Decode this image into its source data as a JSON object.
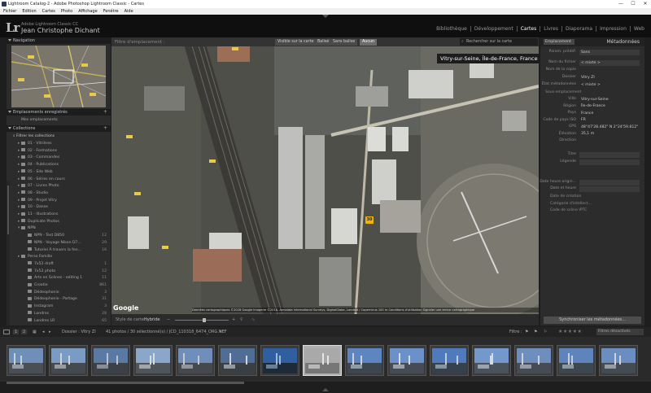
{
  "window": {
    "title": "Lightroom Catalog-2 - Adobe Photoshop Lightroom Classic - Cartes",
    "controls": [
      "—",
      "☐",
      "✕"
    ]
  },
  "menu": [
    "Fichier",
    "Edition",
    "Cartes",
    "Photo",
    "Affichage",
    "Fenêtre",
    "Aide"
  ],
  "identity": {
    "logo": "Lr",
    "product": "Adobe Lightroom Classic CC",
    "user": "Jean Christophe Dichant"
  },
  "modules": {
    "items": [
      "Bibliothèque",
      "Développement",
      "Cartes",
      "Livres",
      "Diaporama",
      "Impression",
      "Web"
    ],
    "active": "Cartes"
  },
  "left_panel": {
    "navigator_title": "Navigation",
    "saved_locations_title": "Emplacements enregistrés",
    "my_locations": "Mes emplacements",
    "collections_title": "Collections",
    "filter_collections": "Filtrer les collections",
    "collections": [
      {
        "toggle": "▸",
        "name": "01 - Vitrières",
        "count": ""
      },
      {
        "toggle": "▸",
        "name": "02 - Formations",
        "count": ""
      },
      {
        "toggle": "▸",
        "name": "03 - Commandes",
        "count": ""
      },
      {
        "toggle": "▸",
        "name": "04 - Publications",
        "count": ""
      },
      {
        "toggle": "▸",
        "name": "05 - Site Web",
        "count": ""
      },
      {
        "toggle": "▸",
        "name": "06 - Séries en cours",
        "count": ""
      },
      {
        "toggle": "▸",
        "name": "07 - Livres Photo",
        "count": ""
      },
      {
        "toggle": "▸",
        "name": "08 - Studio",
        "count": ""
      },
      {
        "toggle": "▸",
        "name": "09 - Projet Vitry",
        "count": ""
      },
      {
        "toggle": "▸",
        "name": "10 - Danse",
        "count": ""
      },
      {
        "toggle": "▸",
        "name": "11 - Illustrations",
        "count": ""
      },
      {
        "toggle": "▸",
        "name": "Duplicate Photos",
        "count": ""
      },
      {
        "toggle": "▾",
        "name": "NPN",
        "count": ""
      },
      {
        "toggle": "",
        "name": "NPN - Test D850",
        "count": "12"
      },
      {
        "toggle": "",
        "name": "NPN - Voyage Nikon D7...",
        "count": "29"
      },
      {
        "toggle": "",
        "name": "Tutoriel À travers la fen...",
        "count": "16"
      },
      {
        "toggle": "▸",
        "name": "Perso Famille",
        "count": ""
      },
      {
        "toggle": "",
        "name": "7x52 draft",
        "count": "1"
      },
      {
        "toggle": "",
        "name": "7x52 photo",
        "count": "12"
      },
      {
        "toggle": "",
        "name": "Arts en Scènes - editing 1",
        "count": "11"
      },
      {
        "toggle": "",
        "name": "Croatie",
        "count": "861"
      },
      {
        "toggle": "",
        "name": "Dédeophonie",
        "count": "3"
      },
      {
        "toggle": "",
        "name": "Dédeophonie - Partage",
        "count": "31"
      },
      {
        "toggle": "",
        "name": "Instagram",
        "count": "3"
      },
      {
        "toggle": "",
        "name": "Londres",
        "count": "28"
      },
      {
        "toggle": "",
        "name": "Londres LR",
        "count": "65"
      }
    ]
  },
  "map": {
    "filter_label": "Filtre d'emplacement :",
    "filter_buttons": [
      "Visible sur la carte",
      "Balisé",
      "Sans balise",
      "Aucun"
    ],
    "active_filter": "Aucun",
    "search_placeholder": "Rechercher sur la carte",
    "location_tag": "Vitry-sur-Seine, Île-de-France, France",
    "pin_label": "30",
    "google": "Google",
    "copyright": "Données cartographiques ©2018 Google Imagerie ©2018, Aerodata International Surveys, DigitalGlobe, Landsat / Copernicus  100 m   Conditions d'utilisation   Signaler une erreur cartographique",
    "toolbar": {
      "style_label": "Style de carte :",
      "style_value": "Hybride"
    }
  },
  "right_panel": {
    "preset_dropdown": "Emplacement",
    "title": "Métadonnées",
    "preset_label": "Param. prédéf.",
    "preset_value": "Sans",
    "rows": [
      {
        "k": "Nom du fichier",
        "v": "< mixte >",
        "field": true
      },
      {
        "k": "Nom de la copie",
        "v": "",
        "field": false
      },
      {
        "k": "Dossier",
        "v": "Vitry ZI",
        "field": false
      },
      {
        "k": "État métadonnées",
        "v": "< mixte >",
        "field": false
      }
    ],
    "section_location": "Sous-emplacement",
    "location_rows": [
      {
        "k": "Ville",
        "v": "Vitry-sur-Seine"
      },
      {
        "k": "Région",
        "v": "Île-de-France"
      },
      {
        "k": "Pays",
        "v": "France"
      },
      {
        "k": "Code de pays ISO",
        "v": "FR"
      },
      {
        "k": "GPS",
        "v": "48°47'28.482\" N 2°24'59.812\" E"
      },
      {
        "k": "Élévation",
        "v": "35,1 m"
      },
      {
        "k": "Direction",
        "v": ""
      }
    ],
    "extra_rows": [
      {
        "k": "Titre",
        "v": ""
      },
      {
        "k": "Légende",
        "v": ""
      }
    ],
    "date_rows": [
      {
        "k": "Date heure origin...",
        "v": ""
      },
      {
        "k": "Date et heure",
        "v": ""
      }
    ],
    "left_rows": [
      "Date de création",
      "Catégorie d'intellect...",
      "Code de scène IPTC"
    ],
    "sync_button": "Synchroniser les métadonnées..."
  },
  "filmstrip": {
    "pages": [
      "1",
      "2"
    ],
    "breadcrumb": "Dossier : Vitry ZI",
    "count_text": "41 photos / 30 sélectionné(s) / JCD_110318_6474_ORG.NEF",
    "filter_label": "Filtre :",
    "filter_value": "Filtres désactivés",
    "stars": "★★★★★"
  },
  "colors": {
    "panel_bg": "#2c2c2c",
    "header_bg": "#1d1d1d",
    "accent_pin": "#f2b400"
  }
}
